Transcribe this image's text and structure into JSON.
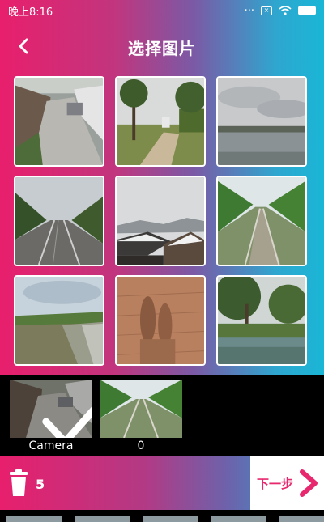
{
  "statusbar": {
    "time": "晚上8:16"
  },
  "header": {
    "title": "选择图片"
  },
  "grid": {
    "photos": [
      {
        "icon": "photo-road-alley"
      },
      {
        "icon": "photo-park-path"
      },
      {
        "icon": "photo-lake-sky"
      },
      {
        "icon": "photo-railway-tracks"
      },
      {
        "icon": "photo-rooftops-snow"
      },
      {
        "icon": "photo-green-tracks"
      },
      {
        "icon": "photo-canal"
      },
      {
        "icon": "photo-shadow-tiles"
      },
      {
        "icon": "photo-pond-trees"
      }
    ]
  },
  "albums": [
    {
      "label": "Camera",
      "selected": true
    },
    {
      "label": "0",
      "selected": false
    }
  ],
  "bottombar": {
    "count": "5",
    "next_label": "下一步"
  },
  "colors": {
    "accent_pink": "#e81f6c",
    "accent_cyan": "#1ab6d6"
  }
}
